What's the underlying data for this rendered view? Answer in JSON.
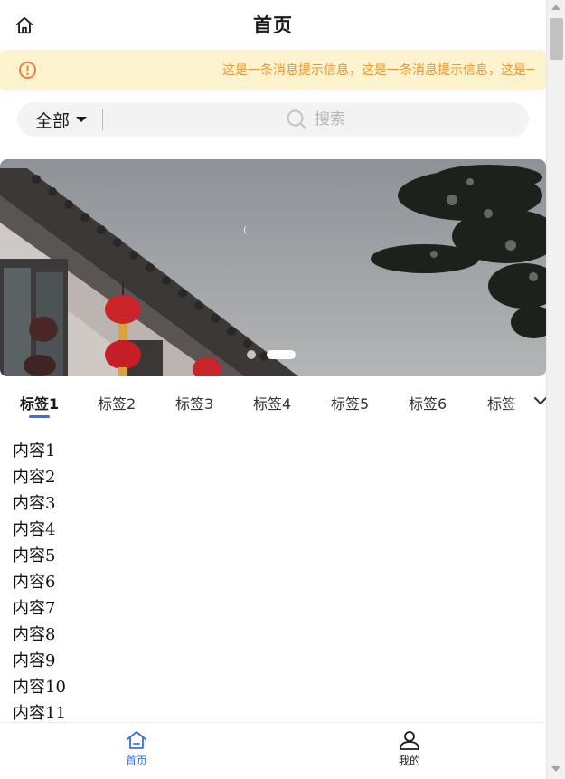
{
  "header": {
    "title": "首页",
    "home_icon": "home-icon"
  },
  "notice": {
    "text": "这是一条消息提示信息，这是一条消息提示信息，这是一条消息提示信息",
    "warn_icon": "warning-circle-icon",
    "close_icon": "close-icon",
    "color": "#e8962f",
    "background": "#fdf4cf"
  },
  "search": {
    "filter_label": "全部",
    "placeholder": "搜索",
    "search_icon": "search-icon"
  },
  "banner": {
    "image": "photo-eaves-lanterns-tree",
    "slide_count": 2,
    "active_slide": 2
  },
  "tabs": {
    "items": [
      "标签1",
      "标签2",
      "标签3",
      "标签4",
      "标签5",
      "标签6",
      "标签"
    ],
    "active_index": 0,
    "more_icon": "chevron-down-icon",
    "accent": "#3c6ee0"
  },
  "content": {
    "items": [
      "内容1",
      "内容2",
      "内容3",
      "内容4",
      "内容5",
      "内容6",
      "内容7",
      "内容8",
      "内容9",
      "内容10",
      "内容11"
    ]
  },
  "bottom_nav": {
    "items": [
      {
        "label": "首页",
        "icon": "home-icon",
        "active": true
      },
      {
        "label": "我的",
        "icon": "user-icon",
        "active": false
      }
    ],
    "active_color": "#3c6ee0"
  }
}
